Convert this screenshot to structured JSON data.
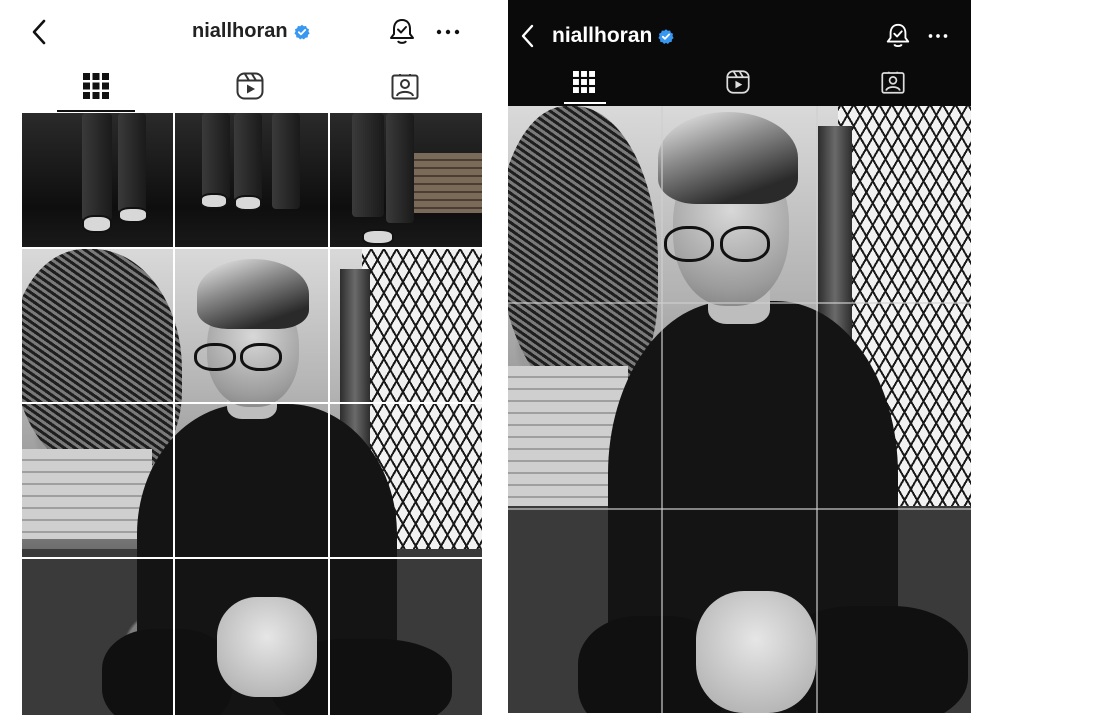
{
  "screens": [
    {
      "theme": "light",
      "header": {
        "username": "niallhoran",
        "verified": true,
        "back_icon": "chevron-left-icon",
        "notification_icon": "bell-icon",
        "more_icon": "more-horizontal-icon"
      },
      "tabs": [
        {
          "name": "posts",
          "icon": "grid-icon",
          "active": true
        },
        {
          "name": "reels",
          "icon": "reels-icon",
          "active": false
        },
        {
          "name": "tagged",
          "icon": "tagged-icon",
          "active": false
        }
      ]
    },
    {
      "theme": "dark",
      "header": {
        "username": "niallhoran",
        "verified": true,
        "back_icon": "chevron-left-icon",
        "notification_icon": "bell-icon",
        "more_icon": "more-horizontal-icon"
      },
      "tabs": [
        {
          "name": "posts",
          "icon": "grid-icon",
          "active": true
        },
        {
          "name": "reels",
          "icon": "reels-icon",
          "active": false
        },
        {
          "name": "tagged",
          "icon": "tagged-icon",
          "active": false
        }
      ]
    }
  ],
  "colors": {
    "verified": "#3897f0",
    "light_text": "#111111",
    "dark_text": "#ffffff",
    "dark_bg": "#0a0a0a"
  }
}
